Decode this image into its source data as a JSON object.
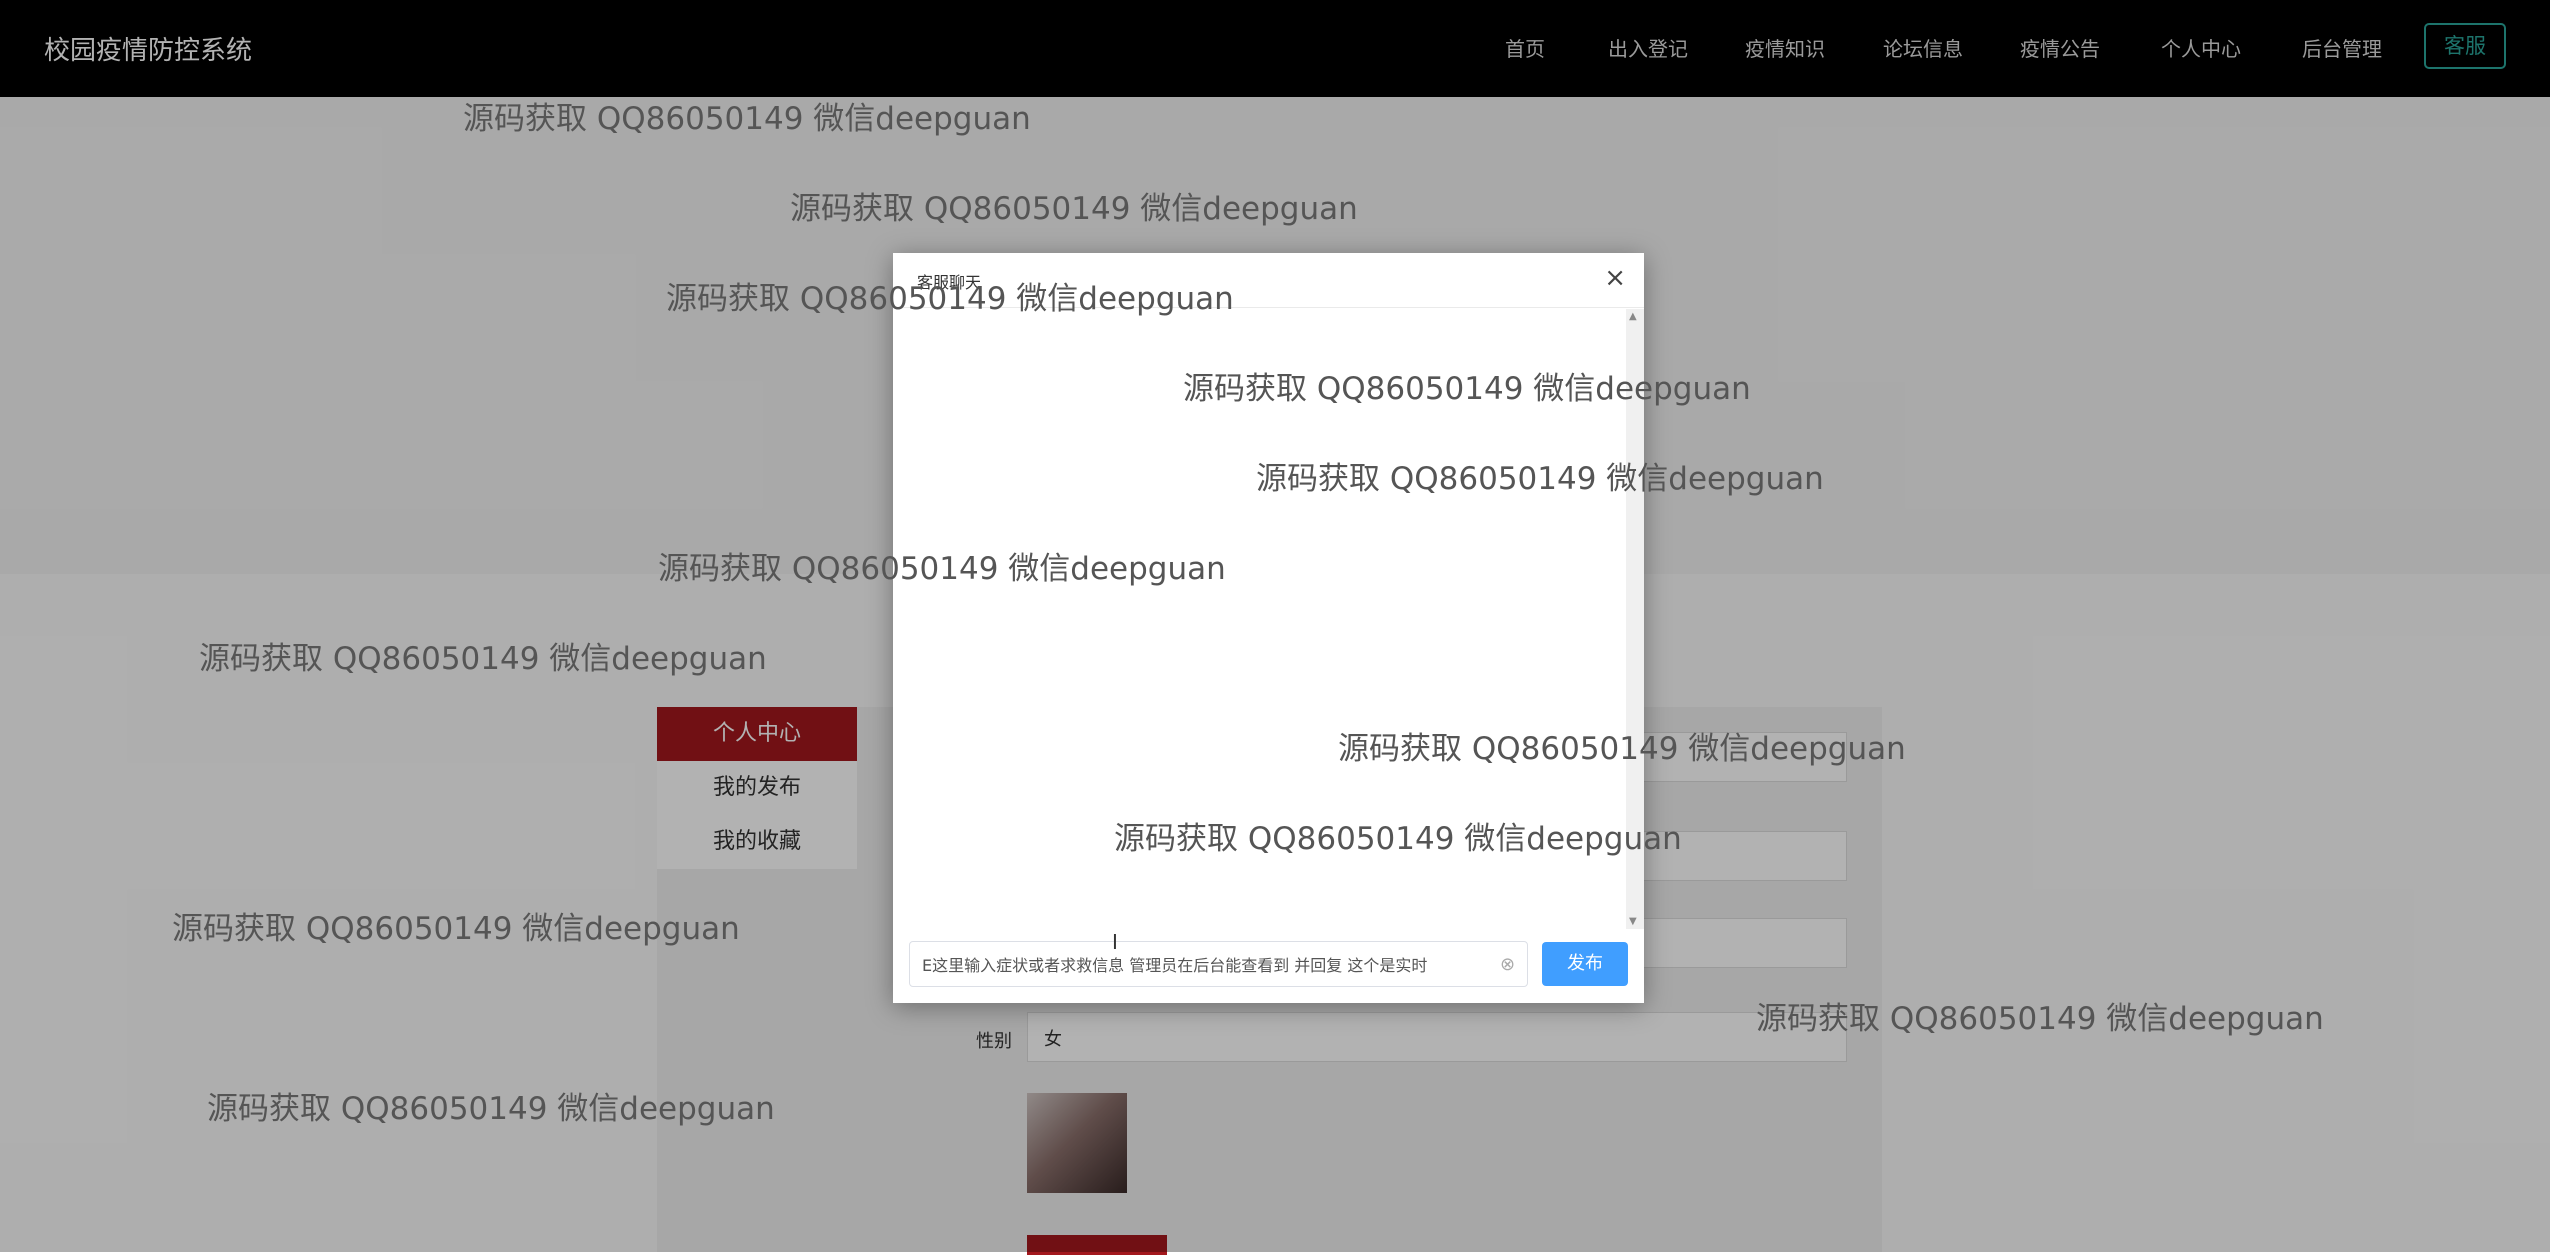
{
  "app": {
    "title": "校园疫情防控系统"
  },
  "nav": {
    "items": [
      "首页",
      "出入登记",
      "疫情知识",
      "论坛信息",
      "疫情公告",
      "个人中心",
      "后台管理"
    ],
    "service_button": "客服"
  },
  "sidebar": {
    "active": "个人中心",
    "items": [
      "我的发布",
      "我的收藏"
    ]
  },
  "form": {
    "gender_label": "性别",
    "gender_value": "女"
  },
  "dialog": {
    "title": "客服聊天",
    "close_glyph": "×",
    "input_value": "E这里输入症状或者求救信息 管理员在后台能查看到 并回复 这个是实时",
    "publish_label": "发布"
  },
  "watermark_text": "源码获取 QQ86050149 微信deepguan",
  "icons": {
    "close": "close-icon",
    "clear": "clear-icon",
    "scroll_up": "scroll-up-icon",
    "scroll_down": "scroll-down-icon",
    "text_cursor": "text-cursor-icon"
  },
  "colors": {
    "navbar": "#000000",
    "accent_red": "#a3181d",
    "service_green": "#2aa79b",
    "publish_blue": "#409eff"
  }
}
